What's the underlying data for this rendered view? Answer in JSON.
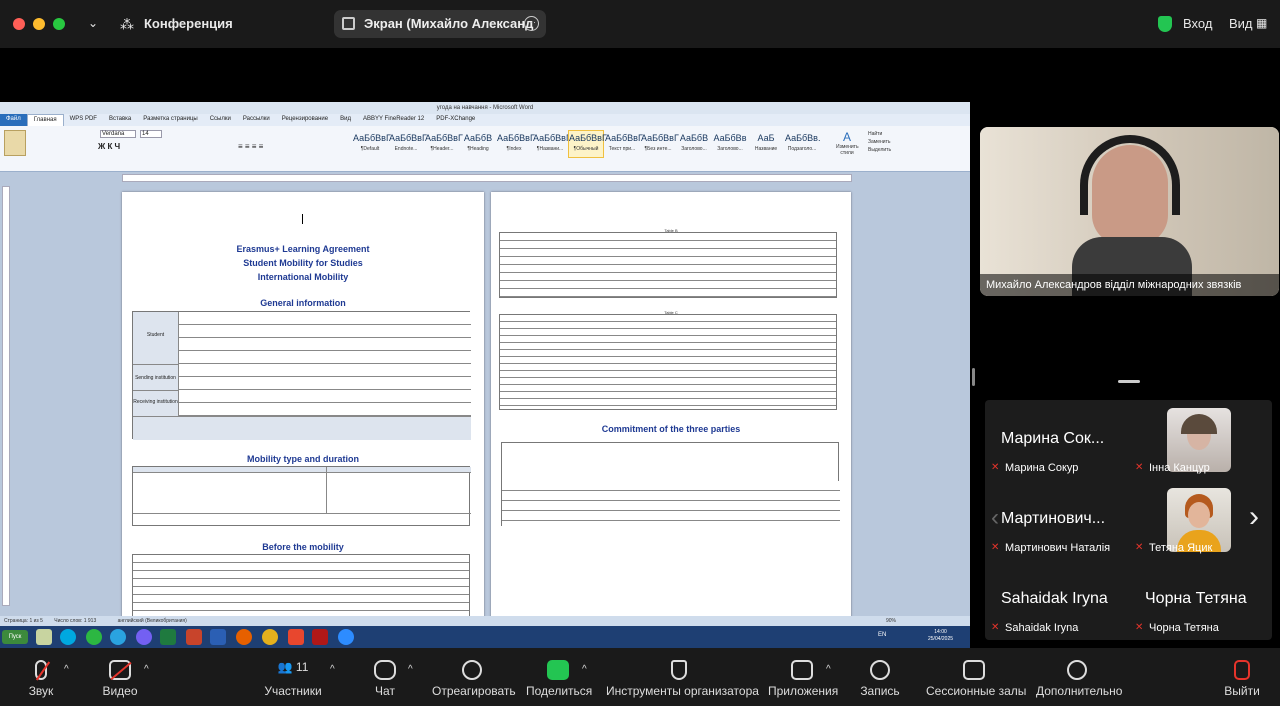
{
  "topbar": {
    "app_title": "Конференция",
    "share_title": "Экран (Михайло Александ",
    "login": "Вход",
    "view": "Вид"
  },
  "word": {
    "window_title": "угода на навчання - Microsoft Word",
    "tabs": [
      "Файл",
      "Главная",
      "WPS PDF",
      "Вставка",
      "Разметка страницы",
      "Ссылки",
      "Рассылки",
      "Рецензирование",
      "Вид",
      "ABBYY FineReader 12",
      "PDF-XChange"
    ],
    "font": "Verdana",
    "size": "14",
    "styles": [
      {
        "sample": "АаБбВвГ",
        "name": "¶Default"
      },
      {
        "sample": "АаБбВвГ",
        "name": "Endnote..."
      },
      {
        "sample": "АаБбВвГ",
        "name": "¶Header..."
      },
      {
        "sample": "АаБбВ",
        "name": "¶Heading"
      },
      {
        "sample": "АаБбВвГ",
        "name": "¶Index"
      },
      {
        "sample": "АаБбВвГ",
        "name": "¶Названи..."
      },
      {
        "sample": "АаБбВвГ",
        "name": "¶Обычный"
      },
      {
        "sample": "АаБбВвГ",
        "name": "Текст при..."
      },
      {
        "sample": "АаБбВвГ",
        "name": "¶Без инте..."
      },
      {
        "sample": "АаБбВ",
        "name": "Заголово..."
      },
      {
        "sample": "АаБбВв",
        "name": "Заголово..."
      },
      {
        "sample": "АаБ",
        "name": "Название"
      },
      {
        "sample": "АаБбВв.",
        "name": "Подзаголо..."
      }
    ],
    "change_styles": "Изменить стили",
    "find": "Найти",
    "replace": "Заменить",
    "select": "Выделить",
    "doc": {
      "title1": "Erasmus+ Learning Agreement",
      "title2": "Student Mobility for Studies",
      "title3": "International Mobility",
      "general": "General information",
      "mobility": "Mobility type and duration",
      "before": "Before the mobility",
      "table_b": "Table B",
      "table_c": "Table C",
      "commitment": "Commitment of the three parties",
      "col_student": "Student",
      "col_sending": "Sending institution",
      "col_receiving": "Receiving institution"
    },
    "status": {
      "page": "Страница: 1 из 5",
      "words": "Число слов: 1 913",
      "lang": "английский (Великобритания)",
      "zoom": "90%"
    },
    "taskbar": {
      "start": "Пуск",
      "lang": "EN",
      "time": "14:00",
      "date": "25/04/2025"
    }
  },
  "selfview": {
    "name": "Михайло Александров відділ міжнародних звязків"
  },
  "gallery": [
    {
      "big": "Марина Сок...",
      "small": "Марина Сокур"
    },
    {
      "big": "",
      "small": "Інна Канцур"
    },
    {
      "big": "Мартинович...",
      "small": "Мартинович Наталія"
    },
    {
      "big": "",
      "small": "Тетяна Яцик"
    },
    {
      "big": "Sahaidak Iryna",
      "small": "Sahaidak Iryna"
    },
    {
      "big": "Чорна Тетяна",
      "small": "Чорна Тетяна"
    }
  ],
  "participants_count": "11",
  "bottombar": {
    "audio": "Звук",
    "video": "Видео",
    "participants": "Участники",
    "chat": "Чат",
    "react": "Отреагировать",
    "share": "Поделиться",
    "host_tools": "Инструменты организатора",
    "apps": "Приложения",
    "record": "Запись",
    "breakout": "Сессионные залы",
    "more": "Дополнительно",
    "leave": "Выйти"
  },
  "colors": {
    "red": "#ff5f57",
    "yellow": "#febc2e",
    "green": "#28c840",
    "share_green": "#23c552",
    "muted": "#e5342b"
  }
}
